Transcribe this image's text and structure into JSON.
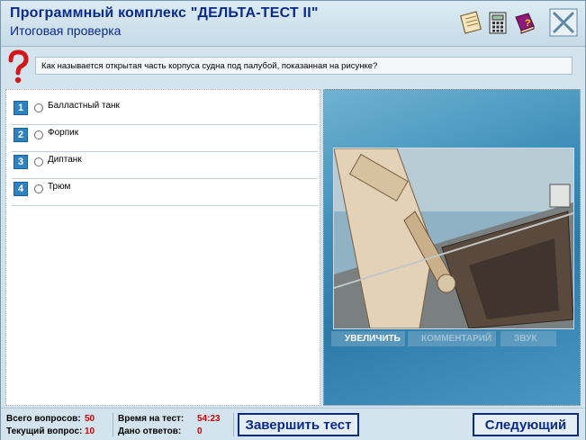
{
  "header": {
    "title": "Программный комплекс \"ДЕЛЬТА-ТЕСТ II\"",
    "subtitle": "Итоговая проверка"
  },
  "question": {
    "text": "Как называется открытая часть корпуса судна под палубой, показанная на рисунке?"
  },
  "answers": [
    {
      "number": "1",
      "label": "Балластный танк"
    },
    {
      "number": "2",
      "label": "Форпик"
    },
    {
      "number": "3",
      "label": "Диптанк"
    },
    {
      "number": "4",
      "label": "Трюм"
    }
  ],
  "image_panel": {
    "zoom_label": "УВЕЛИЧИТЬ",
    "comments_label": "КОММЕНТАРИЙ",
    "sound_label": "ЗВУК"
  },
  "footer": {
    "total_questions_label": "Всего вопросов:",
    "total_questions_value": "50",
    "current_question_label": "Текущий вопрос:",
    "current_question_value": "10",
    "time_label": "Время на тест:",
    "time_value": "54:23",
    "answers_given_label": "Дано ответов:",
    "answers_given_value": "0",
    "finish_button": "Завершить тест",
    "next_button": "Следующий"
  },
  "colors": {
    "title_blue": "#0a2a8a",
    "value_red": "#d00000",
    "number_badge": "#2f82c0"
  }
}
